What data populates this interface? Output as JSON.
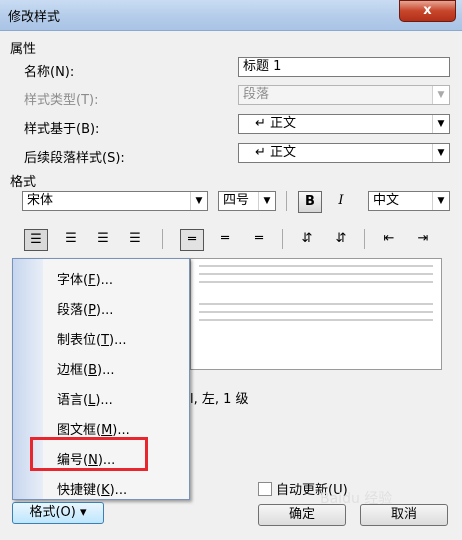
{
  "window": {
    "title": "修改样式",
    "close": "x"
  },
  "properties": {
    "section": "属性",
    "name": {
      "label": "名称(N):",
      "value": "标题 1"
    },
    "type": {
      "label": "样式类型(T):",
      "value": "段落"
    },
    "based_on": {
      "label": "样式基于(B):",
      "value": "↵ 正文"
    },
    "following": {
      "label": "后续段落样式(S):",
      "value": "↵ 正文"
    }
  },
  "format": {
    "section": "格式",
    "font": "宋体",
    "size": "四号",
    "bold": "B",
    "italic": "I",
    "lang": "中文"
  },
  "description_snippet": "l, 左, 1 级",
  "menu": {
    "items": [
      {
        "prefix": "字体(",
        "key": "F",
        "suffix": ")..."
      },
      {
        "prefix": "段落(",
        "key": "P",
        "suffix": ")..."
      },
      {
        "prefix": "制表位(",
        "key": "T",
        "suffix": ")..."
      },
      {
        "prefix": "边框(",
        "key": "B",
        "suffix": ")..."
      },
      {
        "prefix": "语言(",
        "key": "L",
        "suffix": ")..."
      },
      {
        "prefix": "图文框(",
        "key": "M",
        "suffix": ")..."
      },
      {
        "prefix": "编号(",
        "key": "N",
        "suffix": ")..."
      },
      {
        "prefix": "快捷键(",
        "key": "K",
        "suffix": ")..."
      }
    ]
  },
  "buttons": {
    "format": "格式(O) ▾",
    "auto_update": "自动更新(U)",
    "ok": "确定",
    "cancel": "取消"
  },
  "watermark": "Baidu 经验"
}
